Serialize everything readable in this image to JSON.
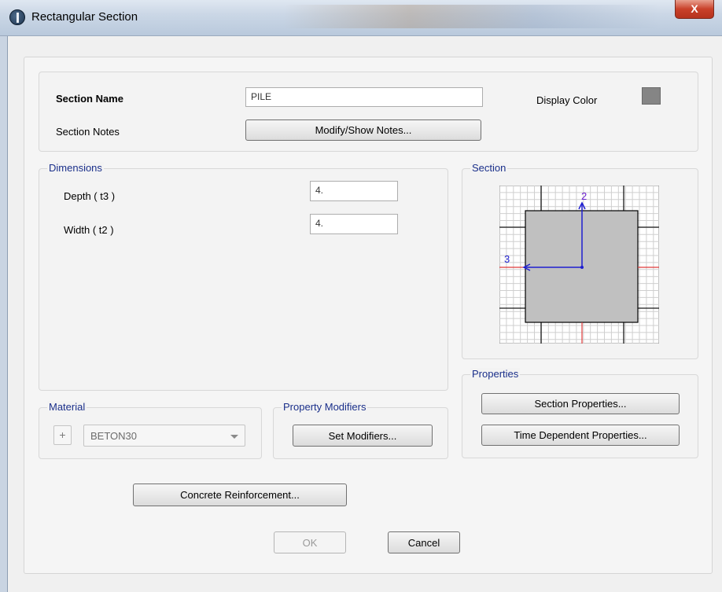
{
  "window": {
    "title": "Rectangular Section",
    "close_glyph": "X",
    "icon": "app-globe-icon"
  },
  "header": {
    "section_name_label": "Section Name",
    "section_name_value": "PILE",
    "section_notes_label": "Section Notes",
    "modify_notes_button": "Modify/Show Notes...",
    "display_color_label": "Display Color",
    "display_color": "#858585"
  },
  "dimensions": {
    "legend": "Dimensions",
    "depth_label": "Depth  ( t3 )",
    "depth_value": "4.",
    "width_label": "Width  ( t2 )",
    "width_value": "4."
  },
  "section_preview": {
    "legend": "Section",
    "axis2_label": "2",
    "axis3_label": "3",
    "fill_color": "#c0c0c0",
    "axis_color": "#1f1fd0",
    "centerline_color": "#e03a3a"
  },
  "properties": {
    "legend": "Properties",
    "section_properties_button": "Section Properties...",
    "time_dependent_button": "Time Dependent Properties..."
  },
  "material": {
    "legend": "Material",
    "add_button": "+",
    "selected": "BETON30"
  },
  "property_modifiers": {
    "legend": "Property Modifiers",
    "set_modifiers_button": "Set Modifiers..."
  },
  "footer": {
    "concrete_reinforcement_button": "Concrete Reinforcement...",
    "ok_button": "OK",
    "cancel_button": "Cancel"
  }
}
